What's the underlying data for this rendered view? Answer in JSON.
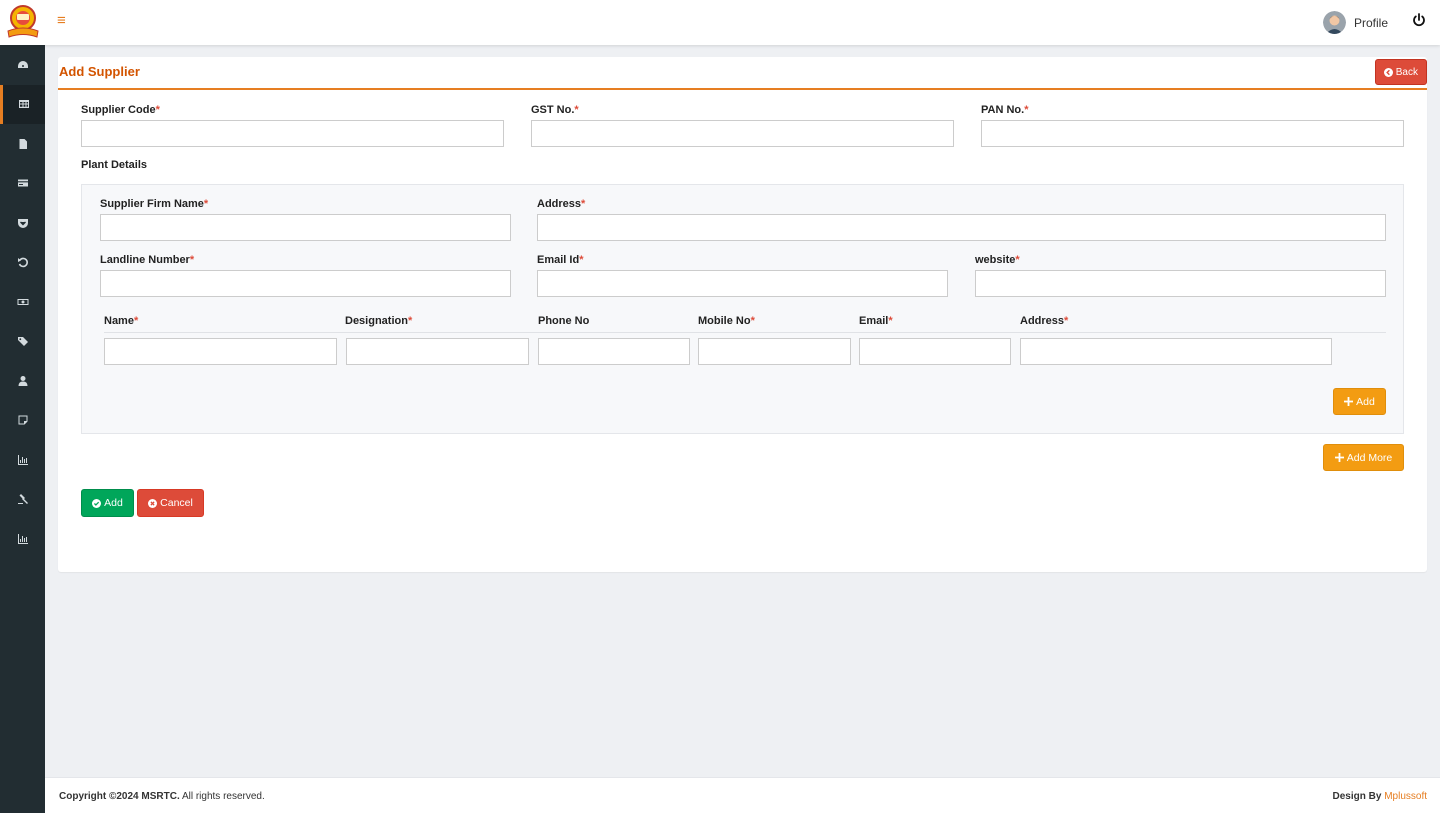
{
  "header": {
    "profile_label": "Profile"
  },
  "icons": {
    "menu": "hamburger-icon",
    "power": "power-icon",
    "sidebar": [
      "dashboard-icon",
      "table-icon",
      "file-icon",
      "card-icon",
      "pocket-icon",
      "undo-icon",
      "money-icon",
      "tags-icon",
      "user-icon",
      "sticky-note-icon",
      "bar-chart-icon",
      "gavel-icon",
      "bar-chart-icon"
    ]
  },
  "page": {
    "title": "Add Supplier",
    "back_label": "Back"
  },
  "form": {
    "supplier_code_label": "Supplier Code",
    "gst_label": "GST No.",
    "pan_label": "PAN No.",
    "plant_details_label": "Plant Details",
    "firm_name_label": "Supplier Firm Name",
    "address_label": "Address",
    "landline_label": "Landline Number",
    "email_id_label": "Email Id",
    "website_label": "website",
    "required_mark": "*"
  },
  "contact_table": {
    "columns": [
      {
        "label": "Name",
        "required": true
      },
      {
        "label": "Designation",
        "required": true
      },
      {
        "label": "Phone No",
        "required": false
      },
      {
        "label": "Mobile No",
        "required": true
      },
      {
        "label": "Email",
        "required": true
      },
      {
        "label": "Address",
        "required": true
      }
    ],
    "add_label": "Add"
  },
  "actions": {
    "add_more_label": "Add More",
    "submit_label": "Add",
    "cancel_label": "Cancel"
  },
  "footer": {
    "copyright_prefix": "Copyright ©2024 MSRTC.",
    "copyright_suffix": " All rights reserved.",
    "design_by": "Design By ",
    "brand": "Mplussoft"
  },
  "colors": {
    "accent": "#e67e22",
    "sidebar_bg": "#222d32",
    "danger": "#dd4b39",
    "warning": "#f39c12",
    "success": "#00a65a"
  }
}
